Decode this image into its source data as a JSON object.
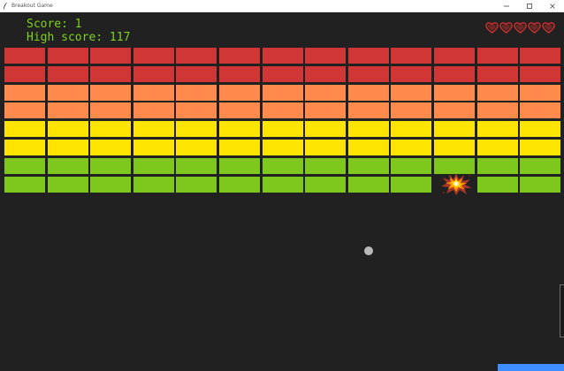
{
  "window": {
    "title": "Breakout Game"
  },
  "hud": {
    "score_text": "Score: 1",
    "high_score_text": "High score: 117",
    "lives": 5,
    "score_color": "#7ed21e",
    "heart_color": "#d32f2f"
  },
  "board": {
    "background": "#212121",
    "columns": 13,
    "row_colors": [
      "#d03636",
      "#d03636",
      "#ff8a4b",
      "#ff8a4b",
      "#ffe400",
      "#ffe400",
      "#7ec81d",
      "#7ec81d"
    ],
    "broken_brick": {
      "row": 7,
      "column": 10
    }
  },
  "ball": {
    "color": "#b9b9b9"
  },
  "paddle": {
    "color": "#3d8eff"
  }
}
